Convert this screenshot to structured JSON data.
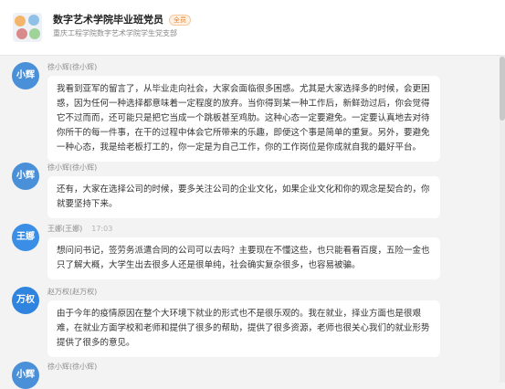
{
  "header": {
    "group_name": "数字艺术学院毕业班党员",
    "badge": "全员",
    "subtitle": "重庆工程学院数字艺术学院学生党支部"
  },
  "messages": [
    {
      "avatar_text": "小辉",
      "avatar_color": "#4a90d9",
      "sender": "徐小辉(徐小辉)",
      "time": "",
      "text": "我看到亚军的留言了，从毕业走向社会，大家会面临很多困惑。尤其是大家选择多的时候，会更困惑，因为任何一种选择都意味着一定程度的放弃。当你得到某一种工作后，新鲜劲过后，你会觉得它不过而而，还可能只是把它当成一个跳板甚至鸡肋。这种心态一定要避免。一定要认真地去对待你所干的每一件事，在干的过程中体会它所带来的乐趣，即便这个事是简单的重复。另外，要避免一种心态，我是给老板打工的，你一定是为自己工作，你的工作岗位是你成就自我的最好平台。"
    },
    {
      "avatar_text": "小辉",
      "avatar_color": "#4a90d9",
      "sender": "徐小辉(徐小辉)",
      "time": "",
      "text": "还有，大家在选择公司的时候，要多关注公司的企业文化，如果企业文化和你的观念是契合的，你就要坚持下来。"
    },
    {
      "avatar_text": "王娜",
      "avatar_color": "#3a8ee6",
      "sender": "王娜(王娜)",
      "time": "17:03",
      "text": "想问问书记，签劳务派遣合同的公司可以去吗？主要现在不懂这些，也只能看看百度，五险一金也只了解大概，大学生出去很多人还是很单纯，社会确实复杂很多，也容易被骗。"
    },
    {
      "avatar_text": "万权",
      "avatar_color": "#2f84e0",
      "sender": "赵万权(赵万权)",
      "time": "",
      "text": "由于今年的疫情原因在整个大环境下就业的形式也不是很乐观的。我在就业，择业方面也是很艰难，在就业方面学校和老师和提供了很多的帮助，提供了很多资源，老师也很关心我们的就业形势提供了很多的意见。"
    },
    {
      "avatar_text": "小辉",
      "avatar_color": "#4a90d9",
      "sender": "徐小辉(徐小辉)",
      "time": "",
      "text": ""
    }
  ]
}
